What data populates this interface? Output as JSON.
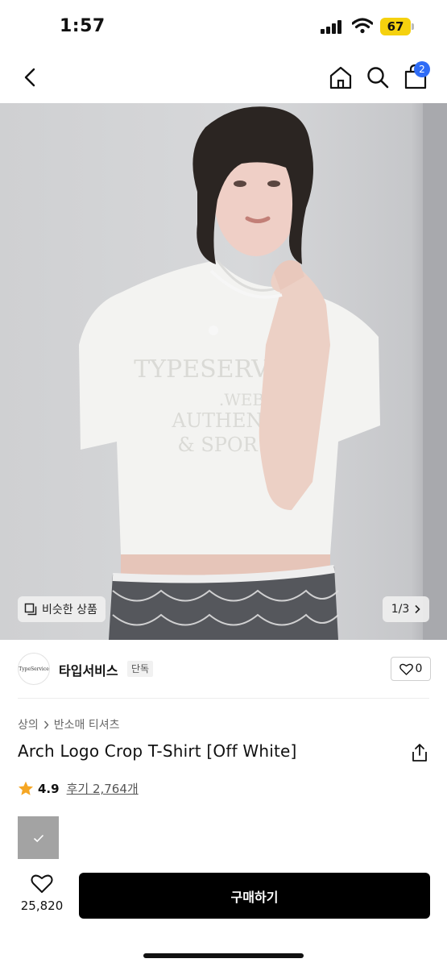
{
  "status_bar": {
    "time": "1:57",
    "battery_level": "67",
    "battery_color": "#f5d10e"
  },
  "nav": {
    "cart_count": "2",
    "badge_color": "#2f6cf6"
  },
  "gallery": {
    "similar_label": "비슷한 상품",
    "page_indicator": "1/3",
    "shirt_print": [
      "TYPESERV",
      ".WEB",
      "AUTHEN",
      "& SPOR"
    ]
  },
  "brand": {
    "logo_text": "TypeService",
    "name": "타입서비스",
    "tag": "단독",
    "like_count": "0"
  },
  "product": {
    "breadcrumb": [
      "상의",
      "반소매 티셔츠"
    ],
    "name": "Arch Logo Crop T-Shirt [Off White]",
    "rating": "4.9",
    "reviews": "후기 2,764개",
    "star_color": "#f5a623",
    "swatch_color": "#a3a3a3"
  },
  "bottom_bar": {
    "wish_count": "25,820",
    "buy_label": "구매하기"
  }
}
